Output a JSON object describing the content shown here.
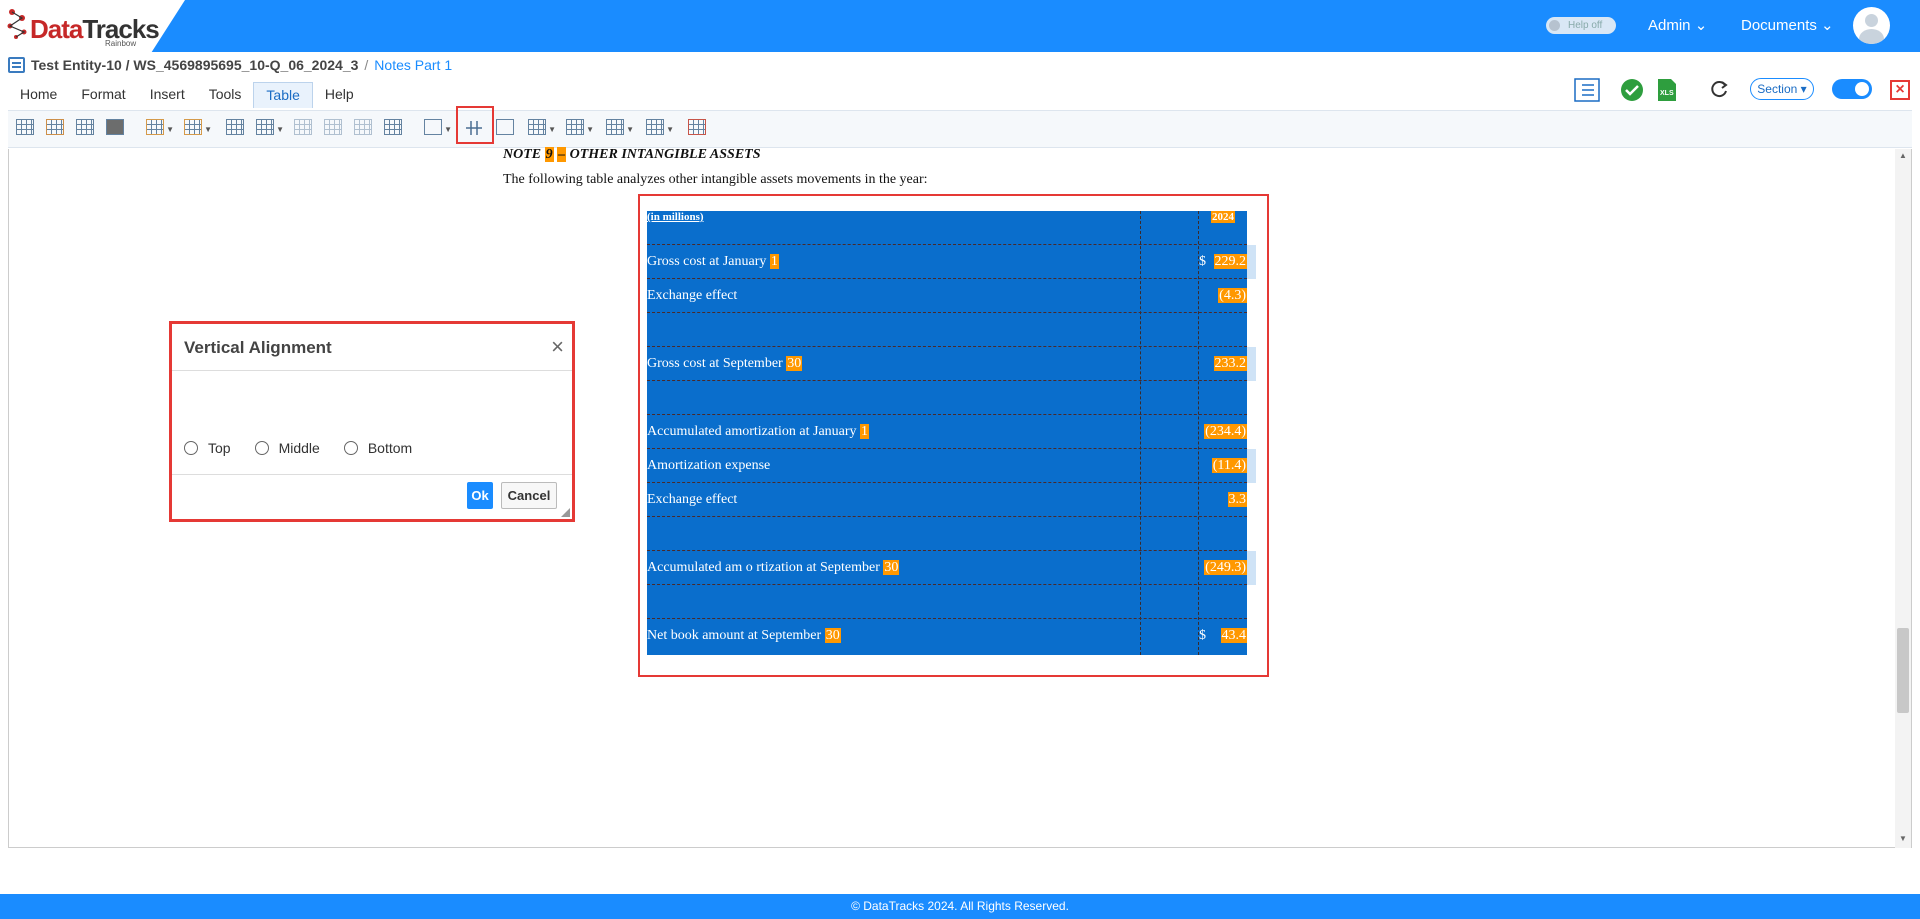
{
  "brand": {
    "name_part1": "Data",
    "name_part2": "Tracks",
    "tagline": "Rainbow"
  },
  "header": {
    "help_toggle": "Help off",
    "admin": "Admin",
    "documents": "Documents"
  },
  "breadcrumb": {
    "entity": "Test Entity-10 / WS_4569895695_10-Q_06_2024_3",
    "separator": "/",
    "section": "Notes Part 1"
  },
  "tabs": [
    {
      "label": "Home"
    },
    {
      "label": "Format"
    },
    {
      "label": "Insert"
    },
    {
      "label": "Tools"
    },
    {
      "label": "Table"
    },
    {
      "label": "Help"
    }
  ],
  "right_tools": {
    "section_label": "Section"
  },
  "note": {
    "title_prefix": "NOTE ",
    "title_number": "9",
    "title_dash": "–",
    "title_rest": " OTHER INTANGIBLE ASSETS",
    "description": "The following table analyzes other intangible assets movements in the year:"
  },
  "table": {
    "header_label": "(in millions)",
    "header_year": "2024",
    "rows": [
      {
        "label": "Gross cost at January ",
        "ref": "1",
        "currency": "$",
        "value": "229.2"
      },
      {
        "label": "Exchange effect",
        "ref": "",
        "currency": "",
        "value": "(4.3)"
      },
      {
        "label": "",
        "ref": "",
        "currency": "",
        "value": ""
      },
      {
        "label": "Gross cost at September ",
        "ref": "30",
        "currency": "",
        "value": "233.2"
      },
      {
        "label": "",
        "ref": "",
        "currency": "",
        "value": ""
      },
      {
        "label": "Accumulated amortization at January ",
        "ref": "1",
        "currency": "",
        "value": "(234.4)"
      },
      {
        "label": "Amortization expense",
        "ref": "",
        "currency": "",
        "value": "(11.4)"
      },
      {
        "label": "Exchange effect",
        "ref": "",
        "currency": "",
        "value": "3.3"
      },
      {
        "label": "",
        "ref": "",
        "currency": "",
        "value": ""
      },
      {
        "label": "Accumulated am o rtization at September ",
        "ref": "30",
        "currency": "",
        "value": "(249.3)"
      },
      {
        "label": "",
        "ref": "",
        "currency": "",
        "value": ""
      },
      {
        "label": "Net book amount at September ",
        "ref": "30",
        "currency": "$",
        "value": "43.4"
      }
    ]
  },
  "dialog": {
    "title": "Vertical Alignment",
    "close": "×",
    "options": [
      {
        "label": "Top"
      },
      {
        "label": "Middle"
      },
      {
        "label": "Bottom"
      }
    ],
    "ok": "Ok",
    "cancel": "Cancel"
  },
  "footer": {
    "text": "© DataTracks 2024. All Rights Reserved."
  },
  "colors": {
    "accent": "#1a8cff",
    "highlight": "#ff9800",
    "selection": "#0a6ecc",
    "frame": "#e53935"
  }
}
